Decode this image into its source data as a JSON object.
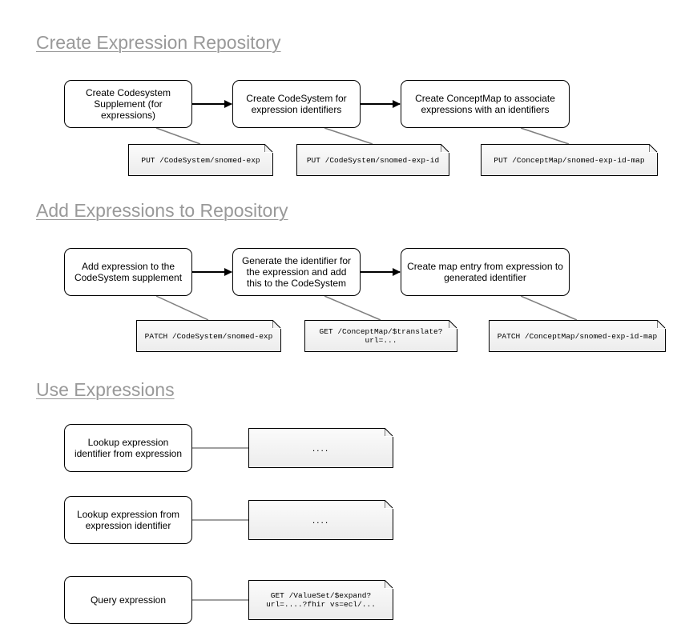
{
  "sections": [
    {
      "title": "Create Expression Repository",
      "steps": [
        "Create Codesystem Supplement (for expressions)",
        "Create CodeSystem for expression identifiers",
        "Create ConceptMap to associate expressions with an identifiers"
      ],
      "notes": [
        "PUT /CodeSystem/snomed-exp",
        "PUT /CodeSystem/snomed-exp-id",
        "PUT /ConceptMap/snomed-exp-id-map"
      ]
    },
    {
      "title": "Add Expressions to Repository",
      "steps": [
        "Add expression to the CodeSystem supplement",
        "Generate the identifier for the expression and add this to the CodeSystem",
        "Create map entry from expression to generated identifier"
      ],
      "notes": [
        "PATCH /CodeSystem/snomed-exp",
        "GET /ConceptMap/$translate?\nurl=...",
        "PATCH /ConceptMap/snomed-exp-id-map"
      ]
    },
    {
      "title": "Use Expressions",
      "steps": [
        "Lookup expression identifier from expression",
        "Lookup expression from expression identifier",
        "Query expression"
      ],
      "notes": [
        "....",
        "....",
        "GET /ValueSet/$expand?\nurl=....?fhir vs=ecl/..."
      ]
    }
  ]
}
